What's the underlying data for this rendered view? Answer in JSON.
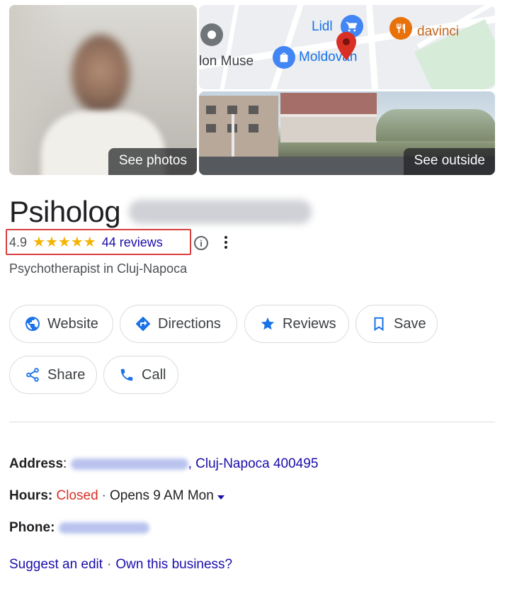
{
  "photos": {
    "see_photos_label": "See photos",
    "see_outside_label": "See outside"
  },
  "map": {
    "labels": {
      "lon_muse": "lon Muse",
      "lidl": "Lidl",
      "moldovan": "Moldovan",
      "davinci": "davinci"
    },
    "colors": {
      "shop_pin": "#4285f4",
      "food_pin": "#e8710a",
      "location_pin": "#d93025",
      "grey_pin": "#70757a",
      "food_text": "#c5661a",
      "shop_text": "#1a73e8"
    }
  },
  "business": {
    "title": "Psiholog",
    "rating": "4.9",
    "stars": "★★★★★",
    "reviews_label": "44 reviews",
    "category": "Psychotherapist in Cluj-Napoca"
  },
  "actions": {
    "website": "Website",
    "directions": "Directions",
    "reviews": "Reviews",
    "save": "Save",
    "share": "Share",
    "call": "Call"
  },
  "info": {
    "address_label": "Address",
    "address_city": "Cluj-Napoca 400495",
    "hours_label": "Hours",
    "hours_status": "Closed",
    "hours_separator": "·",
    "hours_next": "Opens 9 AM Mon",
    "phone_label": "Phone"
  },
  "footer": {
    "suggest_edit": "Suggest an edit",
    "separator": "·",
    "own_business": "Own this business?"
  },
  "colors": {
    "accent_blue": "#1a73e8",
    "link": "#1a0dab",
    "closed_red": "#d93025",
    "star_yellow": "#f4b400",
    "highlight_box": "#d93f3f"
  }
}
